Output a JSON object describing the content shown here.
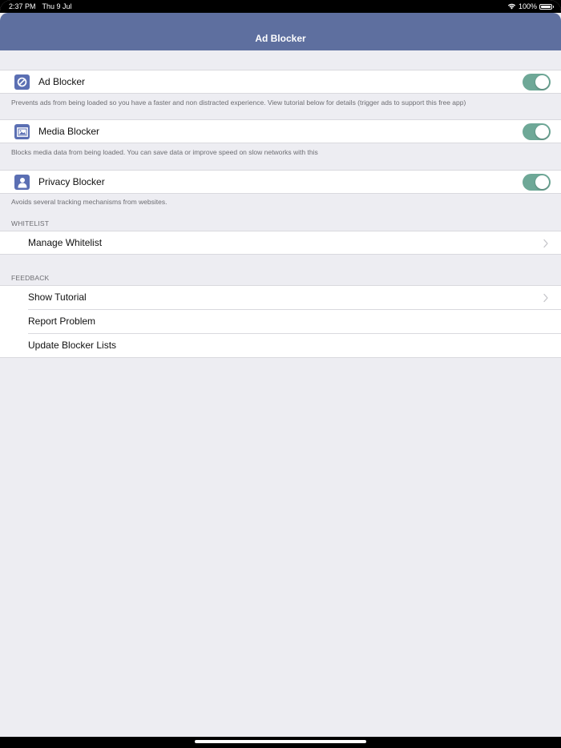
{
  "status_bar": {
    "time": "2:37 PM",
    "date": "Thu 9 Jul",
    "battery": "100%"
  },
  "nav": {
    "title": "Ad Blocker"
  },
  "blockers": [
    {
      "label": "Ad Blocker",
      "icon": "ad-blocker-icon",
      "enabled": true,
      "footer": "Prevents ads from being loaded so you have a faster and non distracted experience. View tutorial below for details (trigger ads to support this free app)"
    },
    {
      "label": "Media Blocker",
      "icon": "image-icon",
      "enabled": true,
      "footer": "Blocks media data from being loaded. You can save data or improve speed on slow networks with this"
    },
    {
      "label": "Privacy Blocker",
      "icon": "person-icon",
      "enabled": true,
      "footer": "Avoids several tracking mechanisms from websites."
    }
  ],
  "whitelist": {
    "header": "WHITELIST",
    "items": [
      {
        "label": "Manage Whitelist"
      }
    ]
  },
  "feedback": {
    "header": "FEEDBACK",
    "items": [
      {
        "label": "Show Tutorial"
      },
      {
        "label": "Report Problem"
      },
      {
        "label": "Update Blocker Lists"
      }
    ]
  },
  "colors": {
    "nav_bar": "#5e6f9f",
    "icon_bg": "#5b6fb3",
    "toggle_on": "#6ea897",
    "background": "#ededf2"
  }
}
